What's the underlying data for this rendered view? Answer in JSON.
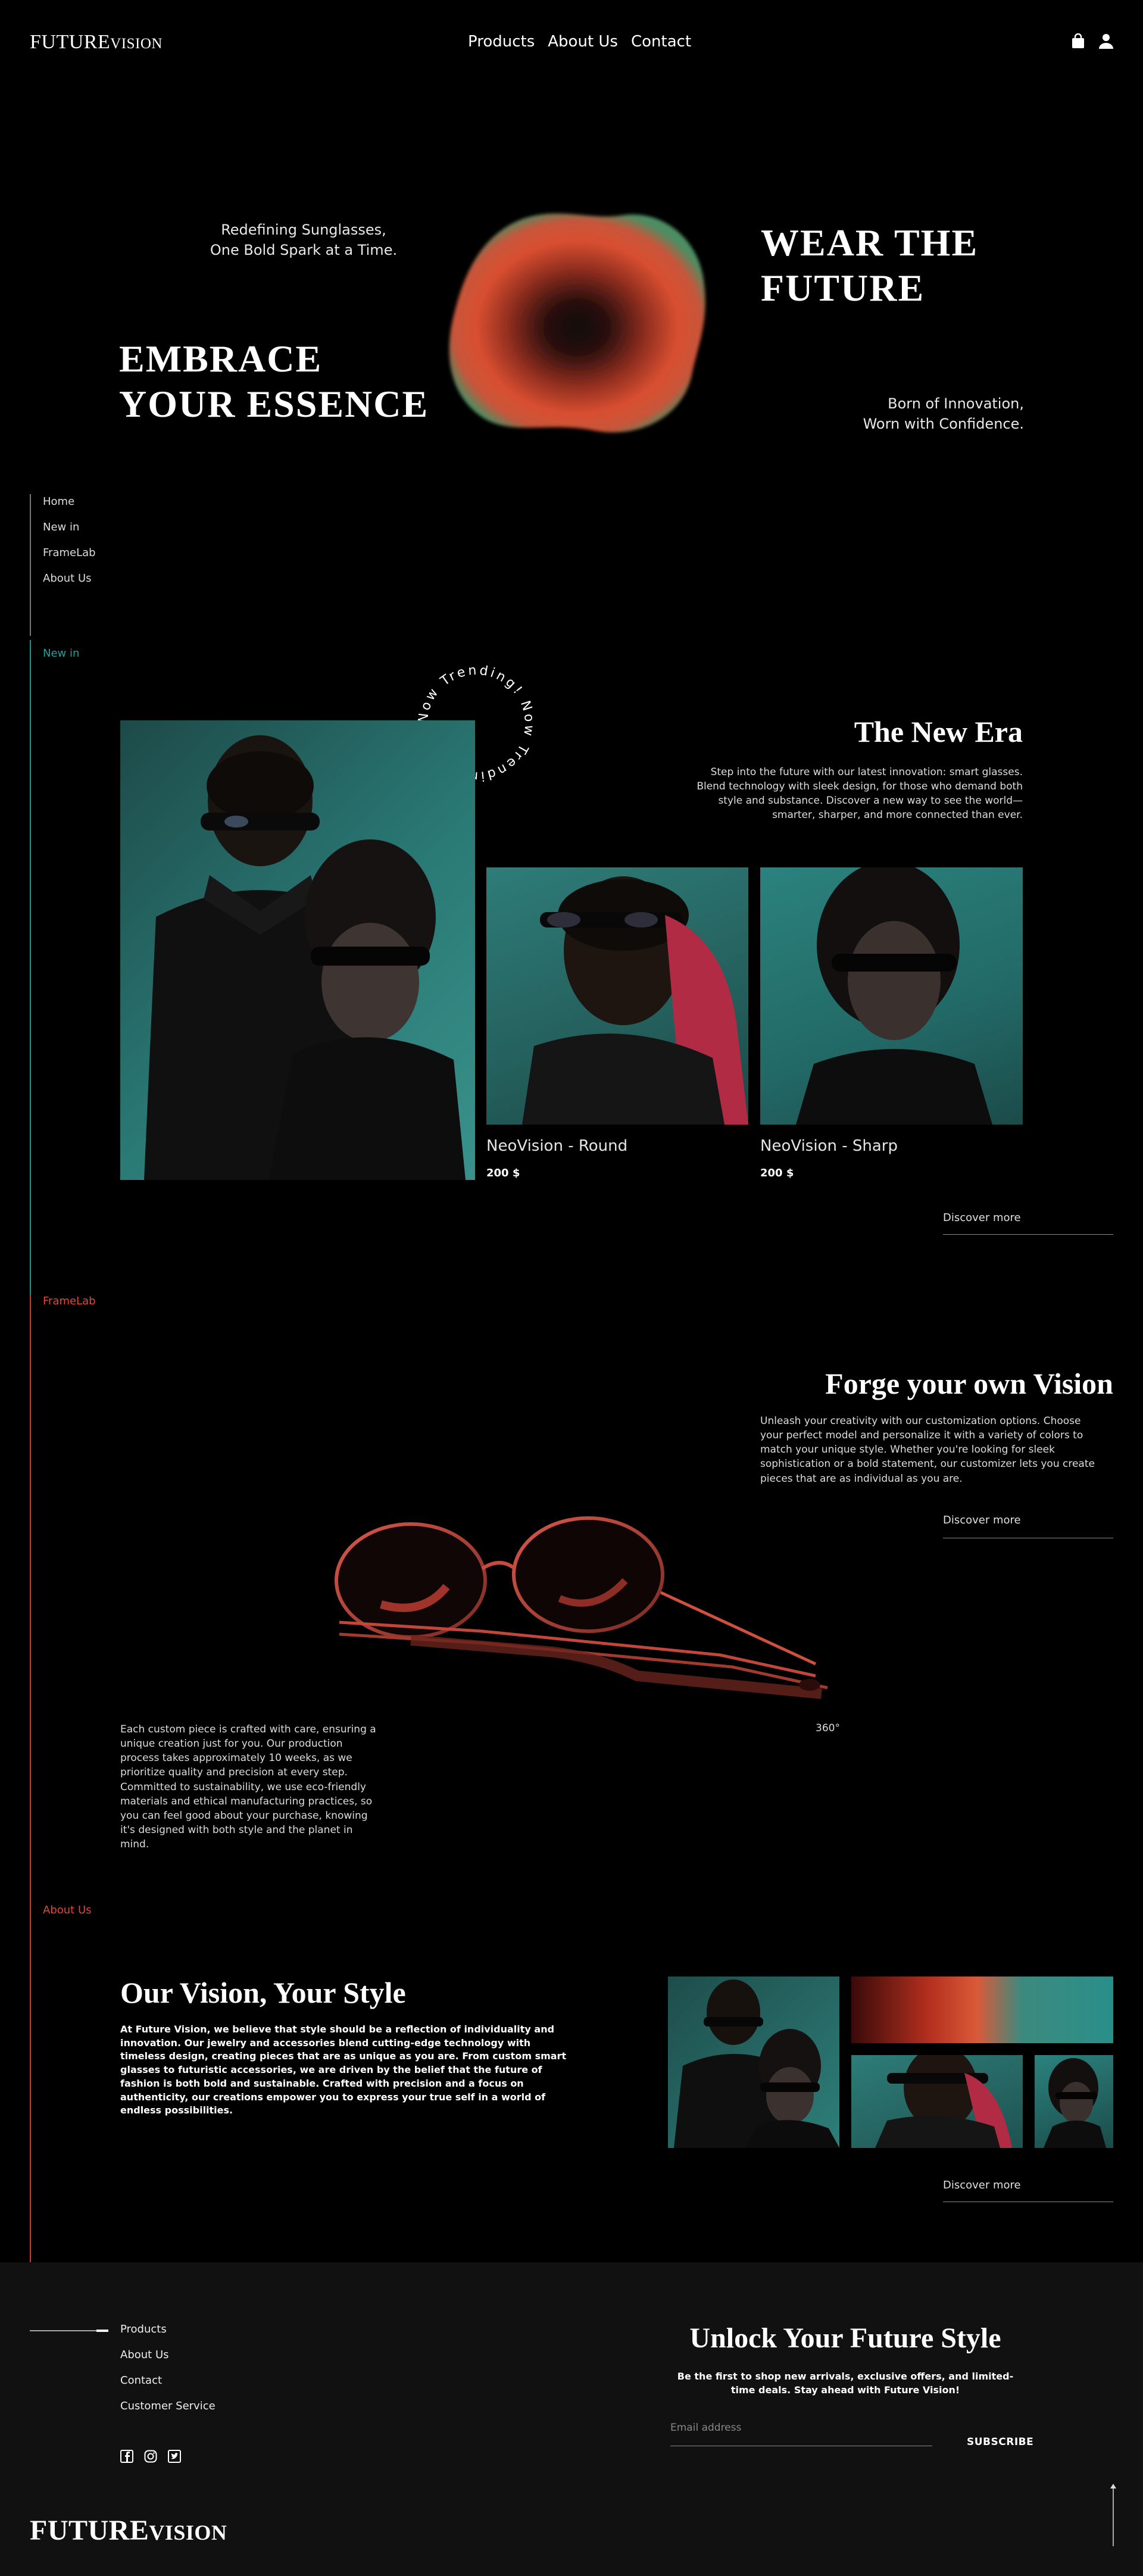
{
  "header": {
    "logo_big": "FUTURE",
    "logo_small": "VISION",
    "nav": [
      "Products",
      "About Us",
      "Contact"
    ],
    "icons": [
      "shopping-bag-icon",
      "user-icon"
    ]
  },
  "hero": {
    "tagline_1": "Redefining Sunglasses,",
    "tagline_2": "One Bold Spark at a Time.",
    "headline_left_1": "EMBRACE",
    "headline_left_2": "YOUR ESSENCE",
    "headline_right_1": "WEAR THE",
    "headline_right_2": "FUTURE",
    "sub_right_1": "Born of Innovation,",
    "sub_right_2": "Worn with Confidence."
  },
  "side_nav": [
    "Home",
    "New in",
    "FrameLab",
    "About Us"
  ],
  "new_in": {
    "tag": "New in",
    "circle_text": "Now Trending! Now Trending!",
    "title": "The New Era",
    "description": "Step into the future with our latest innovation: smart glasses. Blend technology with sleek design, for those who demand both style and substance. Discover a new way to see the world—smarter, sharper, and more connected than ever.",
    "products": [
      {
        "name": "NeoVision - Round",
        "price": "200 $"
      },
      {
        "name": "NeoVision - Sharp",
        "price": "200 $"
      }
    ],
    "discover": "Discover more"
  },
  "framelab": {
    "tag": "FrameLab",
    "title": "Forge your own Vision",
    "description": "Unleash your creativity with our customization options. Choose your perfect model and personalize it with a variety of colors to match your unique style. Whether you're looking for sleek sophistication or a bold statement, our customizer lets you create pieces that are as individual as you are.",
    "discover": "Discover more",
    "rotation_label": "360°",
    "craft_text": "Each custom piece is crafted with care, ensuring a unique creation just for you. Our production process takes approximately 10 weeks, as we prioritize quality and precision at every step. Committed to sustainability, we use eco-friendly materials and ethical manufacturing practices, so you can feel good about your purchase, knowing it's designed with both style and the planet in mind."
  },
  "about": {
    "tag": "About Us",
    "title": "Our Vision, Your Style",
    "description": "At Future Vision, we believe that style should be a reflection of individuality and innovation. Our jewelry and accessories blend cutting-edge technology with timeless design, creating pieces that are as unique as you are. From custom smart glasses to futuristic accessories, we are driven by the belief that the future of fashion is both bold and sustainable. Crafted with precision and a focus on authenticity, our creations empower you to express your true self in a world of endless possibilities.",
    "discover": "Discover more"
  },
  "footer": {
    "links": [
      "Products",
      "About Us",
      "Contact",
      "Customer Service"
    ],
    "social_icons": [
      "facebook-icon",
      "instagram-icon",
      "twitter-icon"
    ],
    "newsletter_title": "Unlock Your Future Style",
    "newsletter_text": "Be the first to shop new arrivals, exclusive offers, and limited-time deals. Stay ahead with Future Vision!",
    "email_placeholder": "Email address",
    "subscribe": "SUBSCRIBE",
    "logo_big": "FUTURE",
    "logo_small": "VISION"
  },
  "colors": {
    "background": "#000000",
    "footer_bg": "#111111",
    "teal": "#2a8f8a",
    "red_accent": "#e0493a",
    "blob_outer": "#4f8f63"
  }
}
